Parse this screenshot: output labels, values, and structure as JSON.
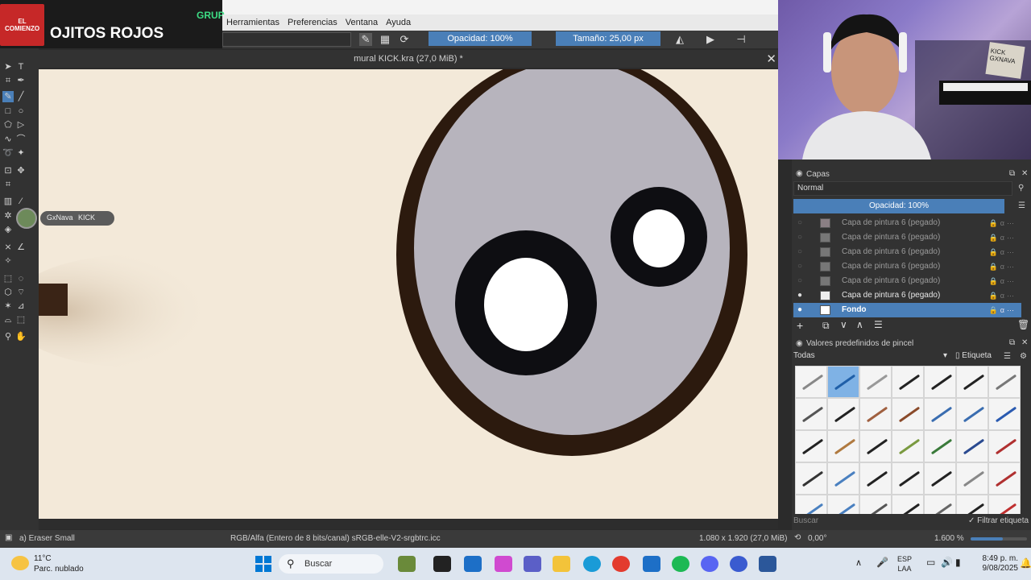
{
  "overlay": {
    "logo_text": "EL COMIENZO",
    "stream_title": "OJITOS ROJOS",
    "group_label": "GRUP"
  },
  "menubar": {
    "items": [
      "Herramientas",
      "Preferencias",
      "Ventana",
      "Ayuda"
    ]
  },
  "toolbar": {
    "opacity_label": "Opacidad: 100%",
    "size_label": "Tamaño: 25,00 px"
  },
  "document": {
    "title": "mural KICK.kra (27,0 MiB) *"
  },
  "streamer_chip": {
    "name": "GxNava",
    "platform": "KICK"
  },
  "webcam": {
    "sign_text": "KICK GXNAVA"
  },
  "layers_panel": {
    "title": "Capas",
    "blend_mode": "Normal",
    "opacity_label": "Opacidad: 100%",
    "layers": [
      {
        "name": "Capa de pintura 6 (pegado)",
        "state": "normal"
      },
      {
        "name": "Capa de pintura 6 (pegado)",
        "state": "normal"
      },
      {
        "name": "Capa de pintura 6 (pegado)",
        "state": "normal"
      },
      {
        "name": "Capa de pintura 6 (pegado)",
        "state": "normal"
      },
      {
        "name": "Capa de pintura 6 (pegado)",
        "state": "normal"
      },
      {
        "name": "Capa de pintura 6 (pegado)",
        "state": "visible"
      },
      {
        "name": "Fondo",
        "state": "active"
      }
    ]
  },
  "brush_panel": {
    "title": "Valores predefinidos de pincel",
    "filter": "Todas",
    "tag_label": "Etiqueta",
    "search_placeholder": "Buscar",
    "filter_tag_label": "Filtrar etiqueta"
  },
  "statusbar": {
    "brush": "a) Eraser Small",
    "color_profile": "RGB/Alfa (Entero de 8 bits/canal)  sRGB-elle-V2-srgbtrc.icc",
    "dimensions": "1.080 x 1.920 (27,0 MiB)",
    "rotation": "0,00°",
    "zoom": "1.600 %"
  },
  "taskbar": {
    "temperature": "11°C",
    "weather": "Parc. nublado",
    "search_label": "Buscar",
    "language": "ESP",
    "region": "LAA",
    "time": "8:49 p. m.",
    "date": "9/08/2025"
  },
  "colors": {
    "accent": "#4a7fb8",
    "canvas_bg": "#f3e9d9",
    "panel_bg": "#323232"
  }
}
